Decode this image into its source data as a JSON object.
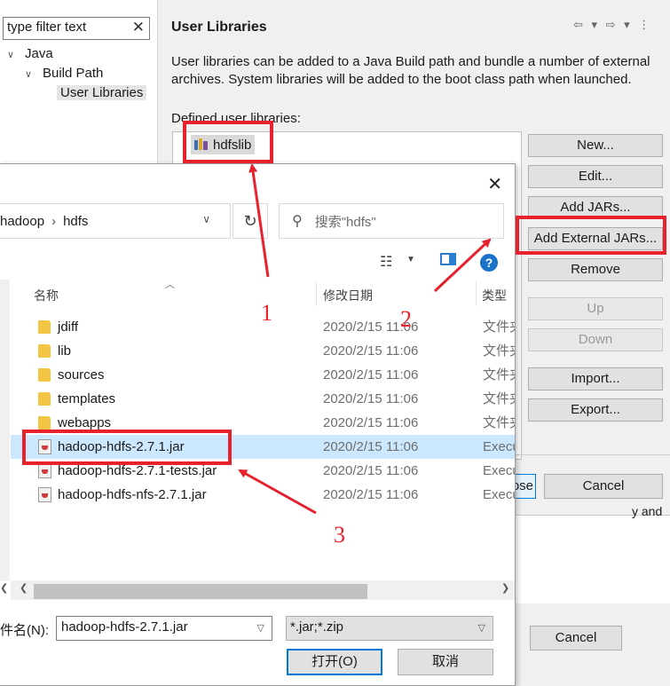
{
  "prefs": {
    "filter_placeholder": "type filter text",
    "filter_clear": "✕",
    "tree": [
      {
        "label": "Java",
        "twisty": "∨"
      },
      {
        "label": "Build Path",
        "twisty": "∨"
      },
      {
        "label": "User Libraries",
        "twisty": ""
      }
    ],
    "title": "User Libraries",
    "nav_icons": "⇦ ▾ ⇨ ▾ ⋮",
    "description": "User libraries can be added to a Java Build path and bundle a number of external archives. System libraries will be added to the boot class path when launched.",
    "defined_label": "Defined user libraries:",
    "libraries": [
      "hdfslib"
    ],
    "buttons": {
      "new": "New...",
      "edit": "Edit...",
      "add_jars": "Add JARs...",
      "add_external_jars": "Add External JARs...",
      "remove": "Remove",
      "up": "Up",
      "down": "Down",
      "import": "Import...",
      "export": "Export..."
    },
    "close_partial": "ose",
    "cancel": "Cancel",
    "partial_text": "y and",
    "cancel_bottom": "Cancel"
  },
  "dialog": {
    "close": "✕",
    "breadcrumb": [
      "hadoop",
      "›",
      "hdfs"
    ],
    "address_chevron": "∨",
    "refresh": "↻",
    "search_placeholder": "搜索\"hdfs\"",
    "columns": {
      "name": "名称",
      "date": "修改日期",
      "type": "类型"
    },
    "files": [
      {
        "name": "jdiff",
        "date": "2020/2/15 11:06",
        "type": "文件夹",
        "kind": "folder"
      },
      {
        "name": "lib",
        "date": "2020/2/15 11:06",
        "type": "文件夹",
        "kind": "folder"
      },
      {
        "name": "sources",
        "date": "2020/2/15 11:06",
        "type": "文件夹",
        "kind": "folder"
      },
      {
        "name": "templates",
        "date": "2020/2/15 11:06",
        "type": "文件夹",
        "kind": "folder"
      },
      {
        "name": "webapps",
        "date": "2020/2/15 11:06",
        "type": "文件夹",
        "kind": "folder"
      },
      {
        "name": "hadoop-hdfs-2.7.1.jar",
        "date": "2020/2/15 11:06",
        "type": "Executable Jar File",
        "kind": "jar",
        "selected": true
      },
      {
        "name": "hadoop-hdfs-2.7.1-tests.jar",
        "date": "2020/2/15 11:06",
        "type": "Executable Jar File",
        "kind": "jar"
      },
      {
        "name": "hadoop-hdfs-nfs-2.7.1.jar",
        "date": "2020/2/15 11:06",
        "type": "Executable Jar File",
        "kind": "jar"
      }
    ],
    "filename_label": "件名(N):",
    "filename_value": "hadoop-hdfs-2.7.1.jar",
    "filetype_value": "*.jar;*.zip",
    "open_label": "打开(O)",
    "cancel_label": "取消"
  },
  "annotations": {
    "numbers": [
      "1",
      "2",
      "3"
    ],
    "color": "#e8212e"
  }
}
